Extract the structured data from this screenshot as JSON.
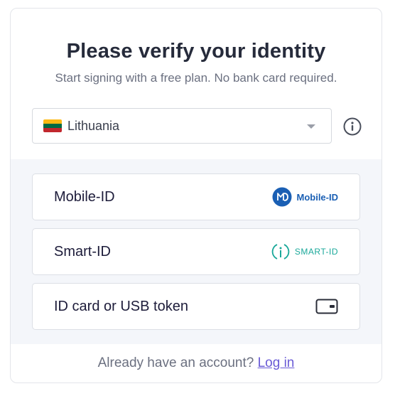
{
  "header": {
    "title": "Please verify your identity",
    "subtitle": "Start signing with a free plan. No bank card required."
  },
  "country_select": {
    "selected": "Lithuania",
    "flag_colors": [
      "#fdb913",
      "#006a44",
      "#c1272d"
    ]
  },
  "info_icon": "info-circle-icon",
  "methods": [
    {
      "label": "Mobile-ID",
      "logo_text": "Mobile-ID",
      "logo_color": "#1a5fb4"
    },
    {
      "label": "Smart-ID",
      "logo_text": "SMART-ID",
      "logo_color": "#1aa89a"
    },
    {
      "label": "ID card or USB token",
      "icon": "card-reader-icon"
    }
  ],
  "footer": {
    "prompt": "Already have an account?",
    "login_label": "Log in"
  }
}
